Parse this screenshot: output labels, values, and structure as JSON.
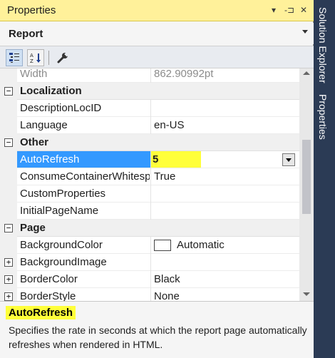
{
  "window": {
    "title": "Properties",
    "pin_glyph": "▾",
    "dock_glyph": "‑⊐",
    "close_glyph": "✕"
  },
  "object_selector": {
    "value": "Report"
  },
  "toolbar": {
    "categorized_icon": "categorized-icon",
    "alphabetical_icon": "alphabetical-icon",
    "property_pages_icon": "wrench-icon"
  },
  "grid": {
    "rows": [
      {
        "type": "property",
        "name": "Width",
        "value": "862.90992pt",
        "disabled": true
      },
      {
        "type": "category",
        "name": "Localization",
        "toggle": "−"
      },
      {
        "type": "property",
        "name": "DescriptionLocID",
        "value": ""
      },
      {
        "type": "property",
        "name": "Language",
        "value": "en-US"
      },
      {
        "type": "category",
        "name": "Other",
        "toggle": "−"
      },
      {
        "type": "property",
        "name": "AutoRefresh",
        "value": "5",
        "selected": true
      },
      {
        "type": "property",
        "name": "ConsumeContainerWhitespace",
        "value": "True"
      },
      {
        "type": "property",
        "name": "CustomProperties",
        "value": ""
      },
      {
        "type": "property",
        "name": "InitialPageName",
        "value": ""
      },
      {
        "type": "category",
        "name": "Page",
        "toggle": "−"
      },
      {
        "type": "property",
        "name": "BackgroundColor",
        "value": "Automatic",
        "swatch": true
      },
      {
        "type": "property",
        "name": "BackgroundImage",
        "value": "",
        "expand": "+"
      },
      {
        "type": "property",
        "name": "BorderColor",
        "value": "Black",
        "expand": "+"
      },
      {
        "type": "property",
        "name": "BorderStyle",
        "value": "None",
        "expand": "+"
      }
    ]
  },
  "description": {
    "title": "AutoRefresh",
    "text": "Specifies the rate in seconds at which the report page automatically refreshes when rendered in HTML."
  },
  "side_tabs": [
    "Solution Explorer",
    "Properties"
  ],
  "colors": {
    "title_bar": "#fff19a",
    "selection": "#3399ff",
    "highlight": "#ffff3a",
    "side_bar": "#2b3b55"
  }
}
